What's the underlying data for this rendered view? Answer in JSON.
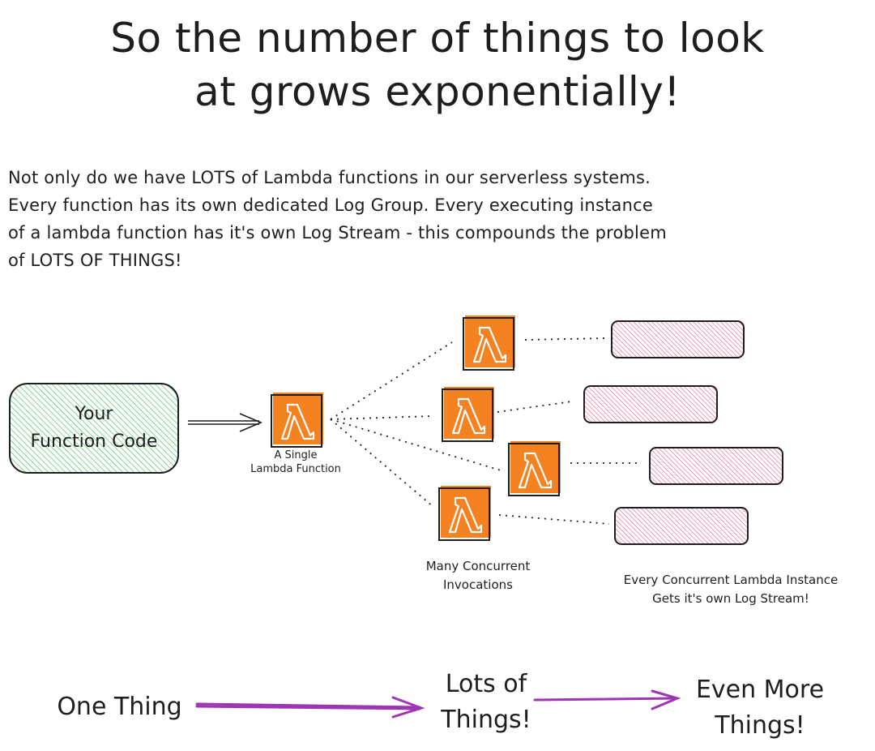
{
  "title": {
    "line1": "So the number of things to look",
    "line2": "at grows exponentially!"
  },
  "intro": {
    "lines": [
      "Not only do we have LOTS of Lambda functions in our serverless systems.",
      "Every function has its own dedicated Log Group.  Every executing instance",
      "of a lambda function has it's own Log Stream - this compounds the problem",
      "of LOTS OF THINGS!"
    ]
  },
  "diagram": {
    "code_box": {
      "line1": "Your",
      "line2": "Function Code",
      "color": "#40c057"
    },
    "single_lambda": {
      "label_line1": "A Single",
      "label_line2": "Lambda Function",
      "icon": "lambda-icon"
    },
    "lambda_color": "#f58220",
    "concurrent": {
      "label_line1": "Many Concurrent",
      "label_line2": "Invocations",
      "count": 4
    },
    "log_streams": {
      "label_line1": "Every Concurrent Lambda Instance",
      "label_line2": "Gets it's own Log Stream!",
      "count": 4,
      "color": "#e64980"
    }
  },
  "flow": {
    "step1": "One Thing",
    "step2_line1": "Lots of",
    "step2_line2": "Things!",
    "step3_line1": "Even More",
    "step3_line2": "Things!",
    "arrow_color": "#9c36b5"
  }
}
